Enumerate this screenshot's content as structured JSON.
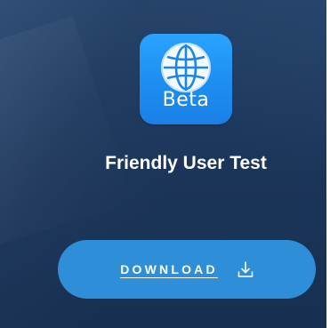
{
  "app": {
    "badge_text": "Beta",
    "icon": "globe-icon"
  },
  "title": "Friendly User Test",
  "download": {
    "label": "DOWNLOAD",
    "icon": "download-arrow-icon"
  },
  "colors": {
    "background": "#1c3658",
    "icon_blue": "#1d8df0",
    "button_blue": "#2f8ed8",
    "text": "#ffffff"
  }
}
